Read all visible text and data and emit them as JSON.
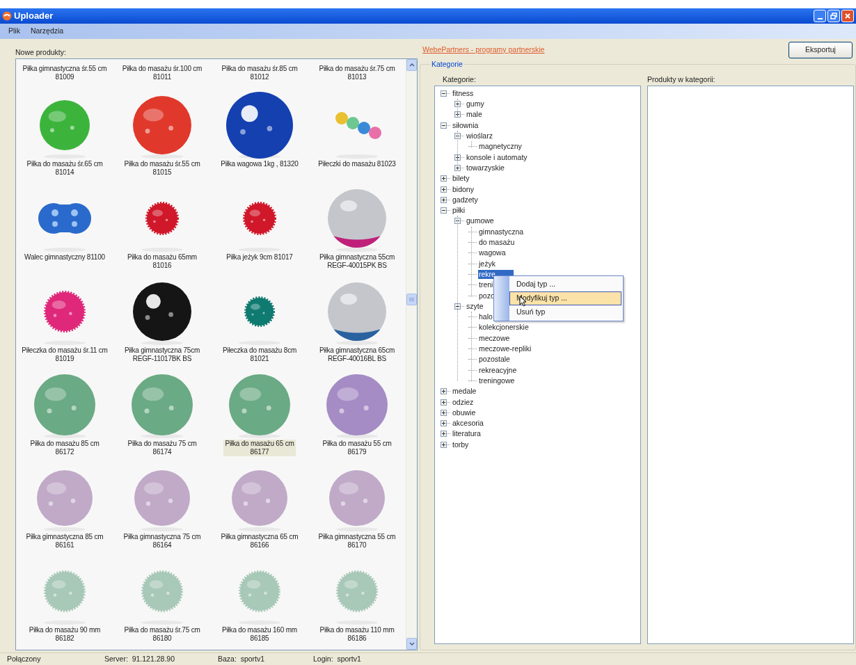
{
  "window": {
    "title": "Uploader"
  },
  "menu": [
    "Plik",
    "Narzędzia"
  ],
  "products": {
    "label": "Nowe produkty:",
    "items": [
      {
        "lines": [
          "Piłka gimnastyczna śr.55 cm",
          "81009"
        ],
        "selected": false
      },
      {
        "lines": [
          "Piłka do masażu śr.100 cm",
          "81011"
        ],
        "selected": false
      },
      {
        "lines": [
          "Piłka do masażu śr.85 cm",
          "81012"
        ],
        "selected": false
      },
      {
        "lines": [
          "Piłka do masażu śr.75 cm",
          "81013"
        ],
        "selected": false
      },
      {
        "kind": "picture",
        "lines": [
          "Piłka do masażu śr.65 cm",
          "81014"
        ],
        "selected": false
      },
      {
        "kind": "picture",
        "lines": [
          "Piłka do masażu śr.55 cm",
          "81015"
        ],
        "selected": false
      },
      {
        "kind": "picture",
        "lines": [
          "Piłka wagowa 1kg , 81320"
        ],
        "selected": false
      },
      {
        "kind": "picture",
        "lines": [
          "Piłeczki do masażu 81023"
        ],
        "selected": false
      },
      {
        "kind": "picture",
        "lines": [
          "Walec gimnastyczny 81100"
        ],
        "selected": false
      },
      {
        "kind": "picture",
        "lines": [
          "Piłka do masażu 65mm",
          "81016"
        ],
        "selected": false
      },
      {
        "kind": "picture",
        "lines": [
          "Piłka jeżyk 9cm 81017"
        ],
        "selected": false
      },
      {
        "kind": "picture",
        "lines": [
          "Piłka gimnastyczna 55cm",
          "REGF-40015PK BS"
        ],
        "selected": false
      },
      {
        "kind": "picture",
        "lines": [
          "Piłeczka do masażu śr.11 cm",
          "81019"
        ],
        "selected": false
      },
      {
        "kind": "picture",
        "lines": [
          "Piłka gimnastyczna 75cm",
          "REGF-11017BK BS"
        ],
        "selected": false
      },
      {
        "kind": "picture",
        "lines": [
          "Piłeczka do masażu 8cm",
          "81021"
        ],
        "selected": false
      },
      {
        "kind": "picture",
        "lines": [
          "Piłka gimnastyczna 65cm",
          "REGF-40016BL BS"
        ],
        "selected": false
      },
      {
        "kind": "picture",
        "lines": [
          "Piłka do masażu 85 cm",
          "86172"
        ],
        "selected": false
      },
      {
        "kind": "picture",
        "lines": [
          "Piłka do masażu 75 cm",
          "86174"
        ],
        "selected": false
      },
      {
        "kind": "picture",
        "lines": [
          "Piłka do masażu 65 cm",
          "86177"
        ],
        "selected": true
      },
      {
        "kind": "picture",
        "lines": [
          "Piłka do masażu 55 cm",
          "86179"
        ],
        "selected": false
      },
      {
        "kind": "picture",
        "lines": [
          "Piłka gimnastyczna 85 cm",
          "86161"
        ],
        "selected": false
      },
      {
        "kind": "picture",
        "lines": [
          "Piłka gimnastyczna 75 cm",
          "86164"
        ],
        "selected": false
      },
      {
        "kind": "picture",
        "lines": [
          "Piłka gimnastyczna 65 cm",
          "86166"
        ],
        "selected": false
      },
      {
        "kind": "picture",
        "lines": [
          "Piłka gimnastyczna 55 cm",
          "86170"
        ],
        "selected": false
      },
      {
        "kind": "picture",
        "lines": [
          "Piłka do masażu 90 mm",
          "86182"
        ],
        "selected": false
      },
      {
        "kind": "picture",
        "lines": [
          "Piłka do masażu śr.75 cm",
          "86180"
        ],
        "selected": false
      },
      {
        "kind": "picture",
        "lines": [
          "Piłka do masażu 160 mm",
          "86185"
        ],
        "selected": false
      },
      {
        "kind": "picture",
        "lines": [
          "Piłka do masażu 110 mm",
          "86186"
        ],
        "selected": false
      }
    ]
  },
  "link": "WebePartners - programy partnerskie",
  "export_button": "Eksportuj",
  "categories": {
    "legend": "Kategorie",
    "tree_label": "Kategorie:",
    "products_label": "Produkty w kategorii:",
    "tree": [
      {
        "label": "fitness",
        "expanded": true,
        "selected": false,
        "children": [
          {
            "label": "gumy",
            "expanded": false,
            "selected": false
          },
          {
            "label": "male",
            "expanded": false,
            "selected": false
          }
        ]
      },
      {
        "label": "siłownia",
        "expanded": true,
        "selected": false,
        "children": [
          {
            "label": "wioślarz",
            "expanded": true,
            "selected": false,
            "children": [
              {
                "label": "magnetyczny",
                "selected": false
              }
            ]
          },
          {
            "label": "konsole i automaty",
            "expanded": false,
            "selected": false
          },
          {
            "label": "towarzyskie",
            "expanded": false,
            "selected": false
          }
        ]
      },
      {
        "label": "bilety",
        "expanded": false,
        "selected": false
      },
      {
        "label": "bidony",
        "expanded": false,
        "selected": false
      },
      {
        "label": "gadzety",
        "expanded": false,
        "selected": false
      },
      {
        "label": "piłki",
        "expanded": true,
        "selected": false,
        "children": [
          {
            "label": "gumowe",
            "expanded": true,
            "selected": false,
            "children": [
              {
                "label": "gimnastyczna",
                "selected": false
              },
              {
                "label": "do masażu",
                "selected": false
              },
              {
                "label": "wagowa",
                "selected": false
              },
              {
                "label": "jeżyk",
                "selected": false
              },
              {
                "label": "rekre",
                "selected": true
              },
              {
                "label": "treni",
                "selected": false
              },
              {
                "label": "pozo",
                "selected": false
              }
            ]
          },
          {
            "label": "szyte",
            "expanded": true,
            "selected": false,
            "children": [
              {
                "label": "halo",
                "selected": false
              },
              {
                "label": "kolekcjonerskie",
                "selected": false
              },
              {
                "label": "meczowe",
                "selected": false
              },
              {
                "label": "meczowe-repliki",
                "selected": false
              },
              {
                "label": "pozostale",
                "selected": false
              },
              {
                "label": "rekreacyjne",
                "selected": false
              },
              {
                "label": "treningowe",
                "selected": false
              }
            ]
          }
        ]
      },
      {
        "label": "medale",
        "expanded": false,
        "selected": false
      },
      {
        "label": "odziez",
        "expanded": false,
        "selected": false
      },
      {
        "label": "obuwie",
        "expanded": false,
        "selected": false
      },
      {
        "label": "akcesoria",
        "expanded": false,
        "selected": false
      },
      {
        "label": "literatura",
        "expanded": false,
        "selected": false
      },
      {
        "label": "torby",
        "expanded": false,
        "selected": false
      }
    ],
    "context_menu": [
      {
        "label": "Dodaj typ ...",
        "selected": false
      },
      {
        "label": "Modyfikuj typ ...",
        "selected": true
      },
      {
        "label": "Usuń typ",
        "selected": false
      }
    ]
  },
  "status_bar": [
    "Połączony",
    "Server:  91.121.28.90",
    "Baza:  sportv1",
    "Login:  sportv1"
  ]
}
